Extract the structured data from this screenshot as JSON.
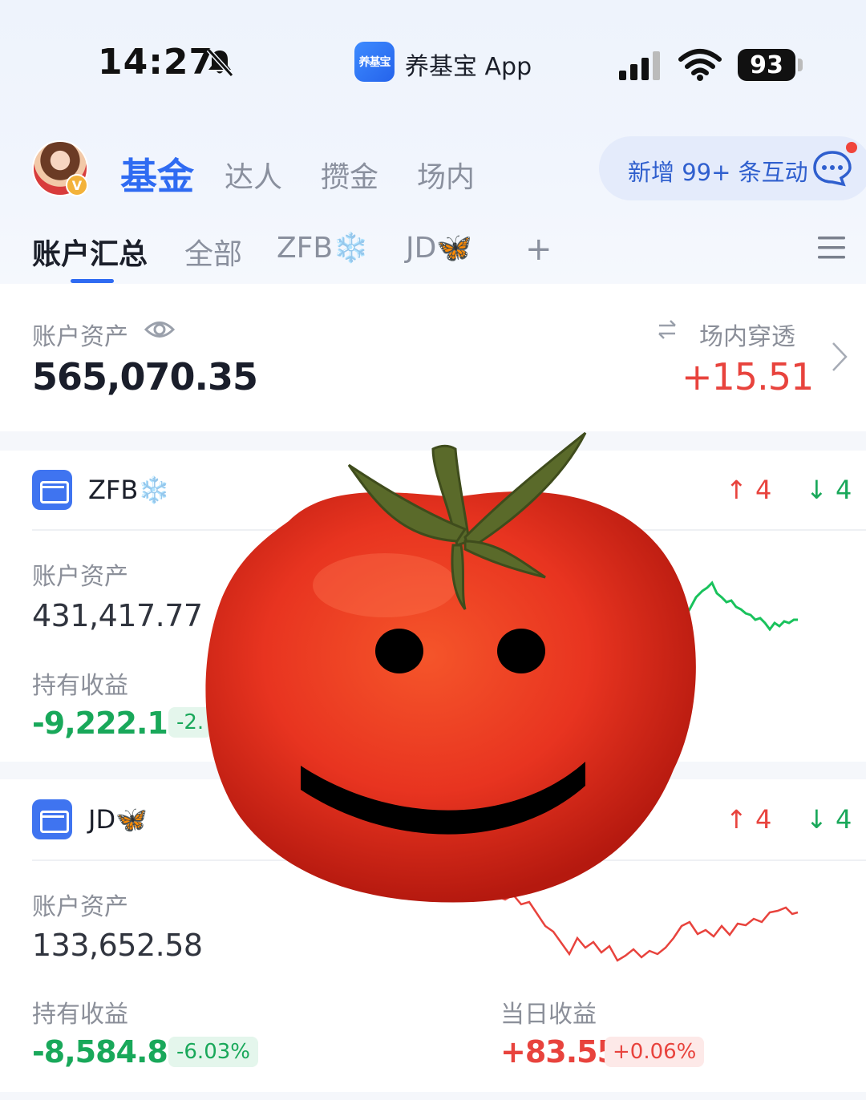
{
  "status_bar": {
    "time": "14:27",
    "app_badge": "养基宝",
    "app_name": "养基宝 App",
    "battery": "93"
  },
  "header": {
    "tabs": [
      {
        "label": "基金",
        "active": true
      },
      {
        "label": "达人",
        "active": false
      },
      {
        "label": "攒金",
        "active": false
      },
      {
        "label": "场内",
        "active": false
      }
    ],
    "interaction_text": "新增 99+ 条互动"
  },
  "sub_tabs": [
    {
      "label": "账户汇总",
      "active": true
    },
    {
      "label": "全部",
      "active": false
    },
    {
      "label": "ZFB❄️",
      "active": false
    },
    {
      "label": "JD🦋",
      "active": false
    }
  ],
  "summary": {
    "asset_label": "账户资产",
    "asset_value": "565,070.35",
    "penetrate_label": "场内穿透",
    "penetrate_value": "+15.51"
  },
  "accounts": [
    {
      "name": "ZFB❄️",
      "up": "↑ 4",
      "down": "↓ 4",
      "asset_label": "账户资产",
      "asset_value": "431,417.77",
      "hold_label": "持有收益",
      "hold_value": "-9,222.15",
      "hold_pct": "-2.",
      "trend_color": "#19c25c"
    },
    {
      "name": "JD🦋",
      "up": "↑ 4",
      "down": "↓ 4",
      "asset_label": "账户资产",
      "asset_value": "133,652.58",
      "hold_label": "持有收益",
      "hold_value": "-8,584.89",
      "hold_pct": "-6.03%",
      "day_label": "当日收益",
      "day_value": "+83.55",
      "day_pct": "+0.06%",
      "trend_color": "#e8433d"
    }
  ],
  "colors": {
    "accent": "#2f6bf2",
    "up": "#e8433d",
    "down": "#19a85a"
  }
}
